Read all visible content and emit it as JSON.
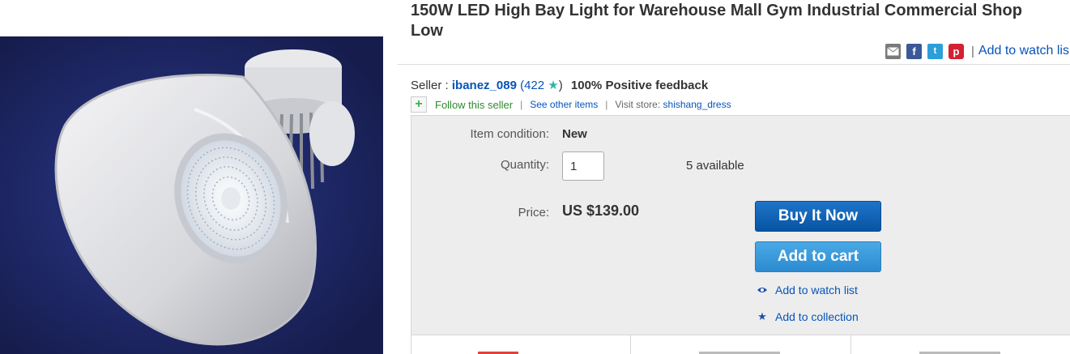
{
  "listing": {
    "title_line1": "150W LED High Bay Light for Warehouse Mall Gym Industrial Commercial Shop",
    "title_line2": "Low"
  },
  "share": {
    "icons": [
      "email-icon",
      "facebook-icon",
      "twitter-icon",
      "pinterest-icon"
    ],
    "fb_glyph": "f",
    "tw_glyph": "t",
    "pin_glyph": "p",
    "separator": "|",
    "watch_label": "Add to watch lis"
  },
  "seller": {
    "label": "Seller :",
    "name": "ibanez_089",
    "open_paren": "(",
    "count": "422",
    "close_paren": ")",
    "feedback": "100% Positive feedback"
  },
  "follow": {
    "label": "Follow this seller",
    "sep": "|",
    "see_other": "See other items",
    "visit_label": "Visit store:",
    "store_name": "shishang_dress"
  },
  "purchase": {
    "condition_label": "Item condition:",
    "condition_value": "New",
    "quantity_label": "Quantity:",
    "quantity_value": "1",
    "available": "5 available",
    "price_label": "Price:",
    "price_value": "US $139.00",
    "buy_now": "Buy It Now",
    "add_to_cart": "Add to cart",
    "add_watch": "Add to watch list",
    "add_collection": "Add to collection"
  },
  "colors": {
    "link": "#0654ba",
    "buy_button": "#0b5fb4",
    "cart_button": "#3797da",
    "follow_green": "#2e8b2e",
    "panel_bg": "#ededed",
    "image_bg": "#1f2761"
  }
}
